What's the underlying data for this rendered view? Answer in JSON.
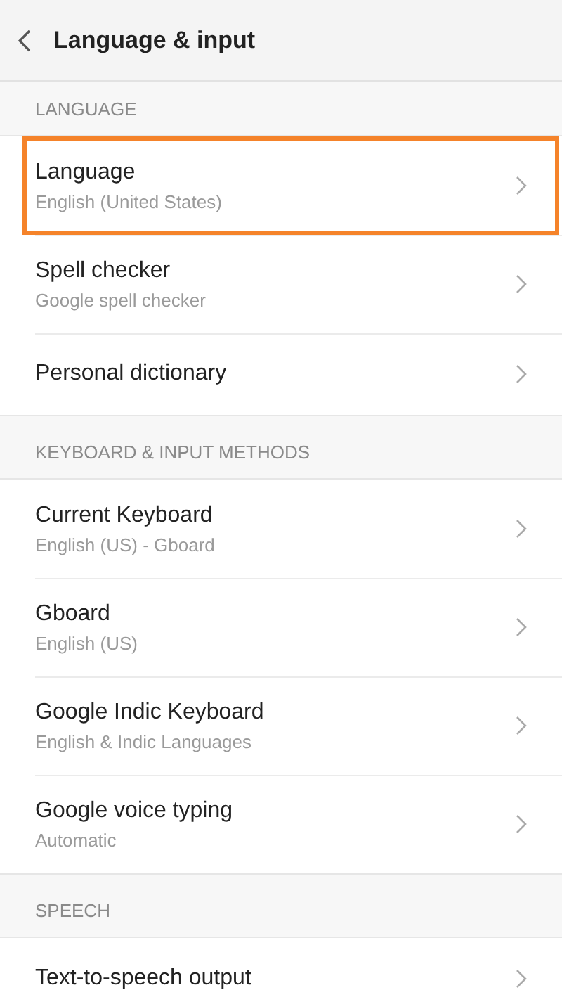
{
  "header": {
    "title": "Language & input"
  },
  "sections": [
    {
      "title": "LANGUAGE",
      "items": [
        {
          "title": "Language",
          "subtitle": "English (United States)",
          "selected": true
        },
        {
          "title": "Spell checker",
          "subtitle": "Google spell checker",
          "selected": false
        },
        {
          "title": "Personal dictionary",
          "selected": false
        }
      ]
    },
    {
      "title": "KEYBOARD & INPUT METHODS",
      "items": [
        {
          "title": "Current Keyboard",
          "subtitle": "English (US) - Gboard",
          "selected": false
        },
        {
          "title": "Gboard",
          "subtitle": "English (US)",
          "selected": false
        },
        {
          "title": "Google Indic Keyboard",
          "subtitle": "English & Indic Languages",
          "selected": false
        },
        {
          "title": "Google voice typing",
          "subtitle": "Automatic",
          "selected": false
        }
      ]
    },
    {
      "title": "SPEECH",
      "items": [
        {
          "title": "Text-to-speech output",
          "selected": false
        }
      ]
    }
  ]
}
